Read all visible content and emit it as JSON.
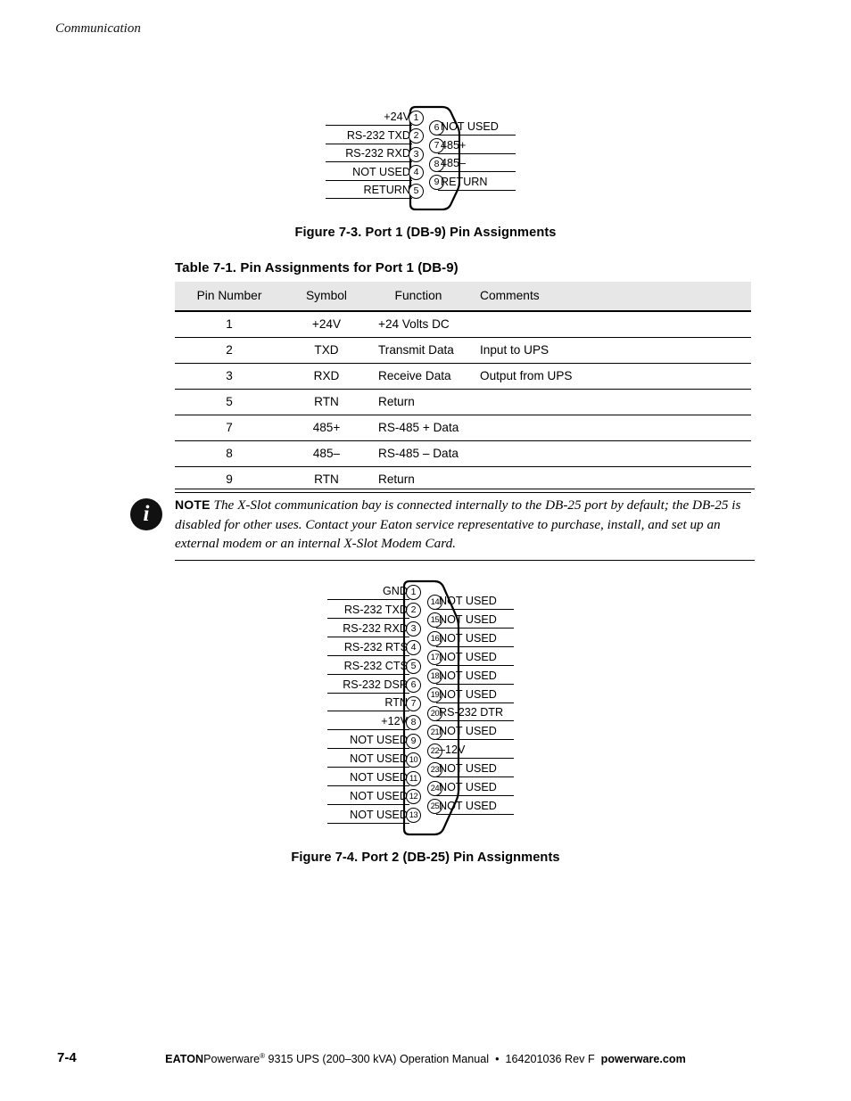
{
  "header": {
    "section": "Communication"
  },
  "figure_db9": {
    "caption": "Figure 7-3. Port 1 (DB-9) Pin Assignments",
    "left_pins": [
      {
        "num": "1",
        "label": "+24V"
      },
      {
        "num": "2",
        "label": "RS-232 TXD"
      },
      {
        "num": "3",
        "label": "RS-232 RXD"
      },
      {
        "num": "4",
        "label": "NOT USED"
      },
      {
        "num": "5",
        "label": "RETURN"
      }
    ],
    "right_pins": [
      {
        "num": "6",
        "label": "NOT USED"
      },
      {
        "num": "7",
        "label": "485+"
      },
      {
        "num": "8",
        "label": "485–"
      },
      {
        "num": "9",
        "label": "RETURN"
      }
    ]
  },
  "table": {
    "caption": "Table 7-1. Pin Assignments for Port 1 (DB-9)",
    "columns": [
      "Pin Number",
      "Symbol",
      "Function",
      "Comments"
    ],
    "rows": [
      {
        "pin": "1",
        "symbol": "+24V",
        "function": "+24 Volts DC",
        "comments": ""
      },
      {
        "pin": "2",
        "symbol": "TXD",
        "function": "Transmit Data",
        "comments": "Input to UPS"
      },
      {
        "pin": "3",
        "symbol": "RXD",
        "function": "Receive Data",
        "comments": "Output from UPS"
      },
      {
        "pin": "5",
        "symbol": "RTN",
        "function": "Return",
        "comments": ""
      },
      {
        "pin": "7",
        "symbol": "485+",
        "function": "RS-485 + Data",
        "comments": ""
      },
      {
        "pin": "8",
        "symbol": "485–",
        "function": "RS-485 – Data",
        "comments": ""
      },
      {
        "pin": "9",
        "symbol": "RTN",
        "function": "Return",
        "comments": ""
      }
    ]
  },
  "note": {
    "keyword": "NOTE",
    "icon": "info-icon",
    "text": "The X-Slot communication bay is connected internally to the DB-25 port by default; the DB-25 is disabled for other uses. Contact your Eaton service representative to purchase, install, and set up an external modem or an internal X-Slot Modem Card."
  },
  "figure_db25": {
    "caption": "Figure 7-4. Port 2 (DB-25) Pin Assignments",
    "left_pins": [
      {
        "num": "1",
        "label": "GND"
      },
      {
        "num": "2",
        "label": "RS-232 TXD"
      },
      {
        "num": "3",
        "label": "RS-232 RXD"
      },
      {
        "num": "4",
        "label": "RS-232 RTS"
      },
      {
        "num": "5",
        "label": "RS-232 CTS"
      },
      {
        "num": "6",
        "label": "RS-232 DSR"
      },
      {
        "num": "7",
        "label": "RTN"
      },
      {
        "num": "8",
        "label": "+12V"
      },
      {
        "num": "9",
        "label": "NOT USED"
      },
      {
        "num": "10",
        "label": "NOT USED"
      },
      {
        "num": "11",
        "label": "NOT USED"
      },
      {
        "num": "12",
        "label": "NOT USED"
      },
      {
        "num": "13",
        "label": "NOT USED"
      }
    ],
    "right_pins": [
      {
        "num": "14",
        "label": "NOT USED"
      },
      {
        "num": "15",
        "label": "NOT USED"
      },
      {
        "num": "16",
        "label": "NOT USED"
      },
      {
        "num": "17",
        "label": "NOT USED"
      },
      {
        "num": "18",
        "label": "NOT USED"
      },
      {
        "num": "19",
        "label": "NOT USED"
      },
      {
        "num": "20",
        "label": "RS-232 DTR"
      },
      {
        "num": "21",
        "label": "NOT USED"
      },
      {
        "num": "22",
        "label": "–12V"
      },
      {
        "num": "23",
        "label": "NOT USED"
      },
      {
        "num": "24",
        "label": "NOT USED"
      },
      {
        "num": "25",
        "label": "NOT USED"
      }
    ]
  },
  "footer": {
    "page_number": "7-4",
    "brand": "EATON",
    "product": "Powerware",
    "registered": "®",
    "description": " 9315 UPS (200–300 kVA) Operation Manual",
    "separator": "•",
    "doc_number": "164201036 Rev F",
    "website": "powerware.com"
  }
}
